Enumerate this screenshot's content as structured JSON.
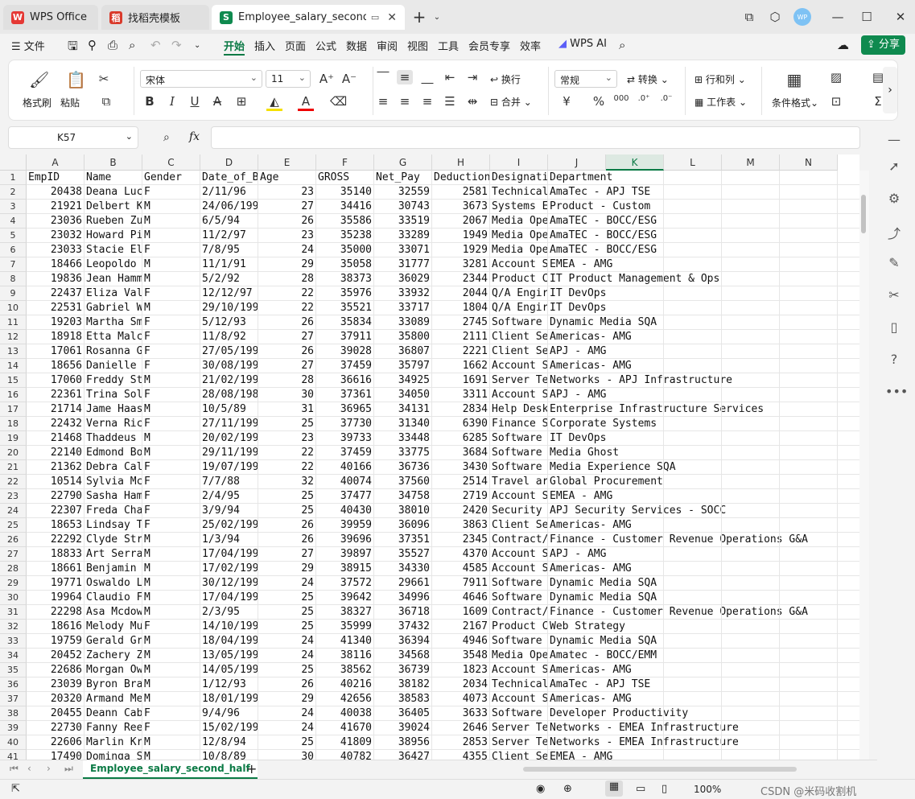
{
  "tabs": [
    {
      "label": "WPS Office",
      "icon": "wps-logo-icon"
    },
    {
      "label": "找稻壳模板",
      "icon": "docer-icon"
    },
    {
      "label": "Employee_salary_second_half",
      "icon": "spreadsheet-icon"
    }
  ],
  "menu": [
    "文件",
    "开始",
    "插入",
    "页面",
    "公式",
    "数据",
    "审阅",
    "视图",
    "工具",
    "会员专享",
    "效率",
    "WPS AI"
  ],
  "share_label": "分享",
  "ribbon": {
    "format_painter": "格式刷",
    "paste": "粘贴",
    "font_name": "宋体",
    "font_size": "11",
    "wrap": "换行",
    "merge": "合并",
    "number_format": "常规",
    "convert": "转换",
    "rows_cols": "行和列",
    "worksheet": "工作表",
    "cond_format": "条件格式"
  },
  "name_box": "K57",
  "fx_label": "fx",
  "columns": [
    "A",
    "B",
    "C",
    "D",
    "E",
    "F",
    "G",
    "H",
    "I",
    "J",
    "K",
    "L",
    "M",
    "N"
  ],
  "header_row": [
    "EmpID",
    "Name",
    "Gender",
    "Date_of_B",
    "Age",
    "GROSS",
    "Net_Pay",
    "Deduction",
    "Designati",
    "Department"
  ],
  "rows": [
    [
      "20438",
      "Deana Luc",
      "F",
      "2/11/96",
      "23",
      "35140",
      "32559",
      "2581",
      "Technical",
      "AmaTec - APJ TSE"
    ],
    [
      "21921",
      "Delbert K",
      "M",
      "24/06/199",
      "27",
      "34416",
      "30743",
      "3673",
      "Systems E",
      "Product - Custom"
    ],
    [
      "23036",
      "Rueben Zu",
      "M",
      "6/5/94",
      "26",
      "35586",
      "33519",
      "2067",
      "Media Ope",
      "AmaTEC - BOCC/ESG"
    ],
    [
      "23032",
      "Howard Pi",
      "M",
      "11/2/97",
      "23",
      "35238",
      "33289",
      "1949",
      "Media Ope",
      "AmaTEC - BOCC/ESG"
    ],
    [
      "23033",
      "Stacie El",
      "F",
      "7/8/95",
      "24",
      "35000",
      "33071",
      "1929",
      "Media Ope",
      "AmaTEC - BOCC/ESG"
    ],
    [
      "18466",
      "Leopoldo",
      "M",
      "11/1/91",
      "29",
      "35058",
      "31777",
      "3281",
      "Account S",
      "EMEA - AMG"
    ],
    [
      "19836",
      "Jean Hamm",
      "M",
      "5/2/92",
      "28",
      "38373",
      "36029",
      "2344",
      "Product C",
      "IT Product Management & Ops"
    ],
    [
      "22437",
      "Eliza Val",
      "F",
      "12/12/97",
      "22",
      "35976",
      "33932",
      "2044",
      "Q/A Engir",
      "IT DevOps"
    ],
    [
      "22531",
      "Gabriel W",
      "M",
      "29/10/199",
      "22",
      "35521",
      "33717",
      "1804",
      "Q/A Engir",
      "IT DevOps"
    ],
    [
      "19203",
      "Martha Sm",
      "F",
      "5/12/93",
      "26",
      "35834",
      "33089",
      "2745",
      "Software",
      "Dynamic Media SQA"
    ],
    [
      "18918",
      "Etta Malc",
      "F",
      "11/8/92",
      "27",
      "37911",
      "35800",
      "2111",
      "Client Se",
      "Americas- AMG"
    ],
    [
      "17061",
      "Rosanna G",
      "F",
      "27/05/199",
      "26",
      "39028",
      "36807",
      "2221",
      "Client Se",
      "APJ - AMG"
    ],
    [
      "18656",
      "Danielle",
      "F",
      "30/08/199",
      "27",
      "37459",
      "35797",
      "1662",
      "Account S",
      "Americas- AMG"
    ],
    [
      "17060",
      "Freddy St",
      "M",
      "21/02/199",
      "28",
      "36616",
      "34925",
      "1691",
      "Server Te",
      "Networks - APJ Infrastructure"
    ],
    [
      "22361",
      "Trina Sol",
      "F",
      "28/08/198",
      "30",
      "37361",
      "34050",
      "3311",
      "Account S",
      "APJ - AMG"
    ],
    [
      "21714",
      "Jame Haas",
      "M",
      "10/5/89",
      "31",
      "36965",
      "34131",
      "2834",
      "Help Desk",
      "Enterprise Infrastructure Services"
    ],
    [
      "22432",
      "Verna Ric",
      "F",
      "27/11/199",
      "25",
      "37730",
      "31340",
      "6390",
      "Finance S",
      "Corporate Systems"
    ],
    [
      "21468",
      "Thaddeus",
      "M",
      "20/02/199",
      "23",
      "39733",
      "33448",
      "6285",
      "Software",
      "IT DevOps"
    ],
    [
      "22140",
      "Edmond Bo",
      "M",
      "29/11/199",
      "22",
      "37459",
      "33775",
      "3684",
      "Software",
      "Media Ghost"
    ],
    [
      "21362",
      "Debra Cal",
      "F",
      "19/07/199",
      "22",
      "40166",
      "36736",
      "3430",
      "Software",
      "Media Experience SQA"
    ],
    [
      "10514",
      "Sylvia Mc",
      "F",
      "7/7/88",
      "32",
      "40074",
      "37560",
      "2514",
      "Travel ar",
      "Global Procurement"
    ],
    [
      "22790",
      "Sasha Ham",
      "F",
      "2/4/95",
      "25",
      "37477",
      "34758",
      "2719",
      "Account S",
      "EMEA - AMG"
    ],
    [
      "22307",
      "Freda Cha",
      "F",
      "3/9/94",
      "25",
      "40430",
      "38010",
      "2420",
      "Security",
      "APJ Security Services - SOCC"
    ],
    [
      "18653",
      "Lindsay T",
      "F",
      "25/02/199",
      "26",
      "39959",
      "36096",
      "3863",
      "Client Se",
      "Americas- AMG"
    ],
    [
      "22292",
      "Clyde Str",
      "M",
      "1/3/94",
      "26",
      "39696",
      "37351",
      "2345",
      "Contract/",
      "Finance - Customer Revenue Operations G&A"
    ],
    [
      "18833",
      "Art Serra",
      "M",
      "17/04/199",
      "27",
      "39897",
      "35527",
      "4370",
      "Account S",
      "APJ - AMG"
    ],
    [
      "18661",
      "Benjamin",
      "M",
      "17/02/199",
      "29",
      "38915",
      "34330",
      "4585",
      "Account S",
      "Americas- AMG"
    ],
    [
      "19771",
      "Oswaldo L",
      "M",
      "30/12/199",
      "24",
      "37572",
      "29661",
      "7911",
      "Software",
      "Dynamic Media SQA"
    ],
    [
      "19964",
      "Claudio F",
      "M",
      "17/04/199",
      "25",
      "39642",
      "34996",
      "4646",
      "Software",
      "Dynamic Media SQA"
    ],
    [
      "22298",
      "Asa Mcdow",
      "M",
      "2/3/95",
      "25",
      "38327",
      "36718",
      "1609",
      "Contract/",
      "Finance - Customer Revenue Operations G&A"
    ],
    [
      "18616",
      "Melody Mu",
      "F",
      "14/10/199",
      "25",
      "35999",
      "37432",
      "2167",
      "Product C",
      "Web Strategy"
    ],
    [
      "19759",
      "Gerald Gr",
      "M",
      "18/04/199",
      "24",
      "41340",
      "36394",
      "4946",
      "Software",
      "Dynamic Media SQA"
    ],
    [
      "20452",
      "Zachery Z",
      "M",
      "13/05/199",
      "24",
      "38116",
      "34568",
      "3548",
      "Media Ope",
      "Amatec - BOCC/EMM"
    ],
    [
      "22686",
      "Morgan Ow",
      "M",
      "14/05/199",
      "25",
      "38562",
      "36739",
      "1823",
      "Account S",
      "Americas- AMG"
    ],
    [
      "23039",
      "Byron Bra",
      "M",
      "1/12/93",
      "26",
      "40216",
      "38182",
      "2034",
      "Technical",
      "AmaTec - APJ TSE"
    ],
    [
      "20320",
      "Armand Me",
      "M",
      "18/01/199",
      "29",
      "42656",
      "38583",
      "4073",
      "Account S",
      "Americas- AMG"
    ],
    [
      "20455",
      "Deann Cab",
      "F",
      "9/4/96",
      "24",
      "40038",
      "36405",
      "3633",
      "Software",
      "Developer Productivity"
    ],
    [
      "22730",
      "Fanny Ree",
      "F",
      "15/02/199",
      "24",
      "41670",
      "39024",
      "2646",
      "Server Te",
      "Networks - EMEA Infrastructure"
    ],
    [
      "22606",
      "Marlin Kr",
      "M",
      "12/8/94",
      "25",
      "41809",
      "38956",
      "2853",
      "Server Te",
      "Networks - EMEA Infrastructure"
    ],
    [
      "17490",
      "Dominga S",
      "M",
      "10/8/89",
      "30",
      "40782",
      "36427",
      "4355",
      "Client Se",
      "EMEA - AMG"
    ]
  ],
  "sheet_tab": "Employee_salary_second_half",
  "zoom": "100%",
  "watermark": "CSDN @米码收割机"
}
